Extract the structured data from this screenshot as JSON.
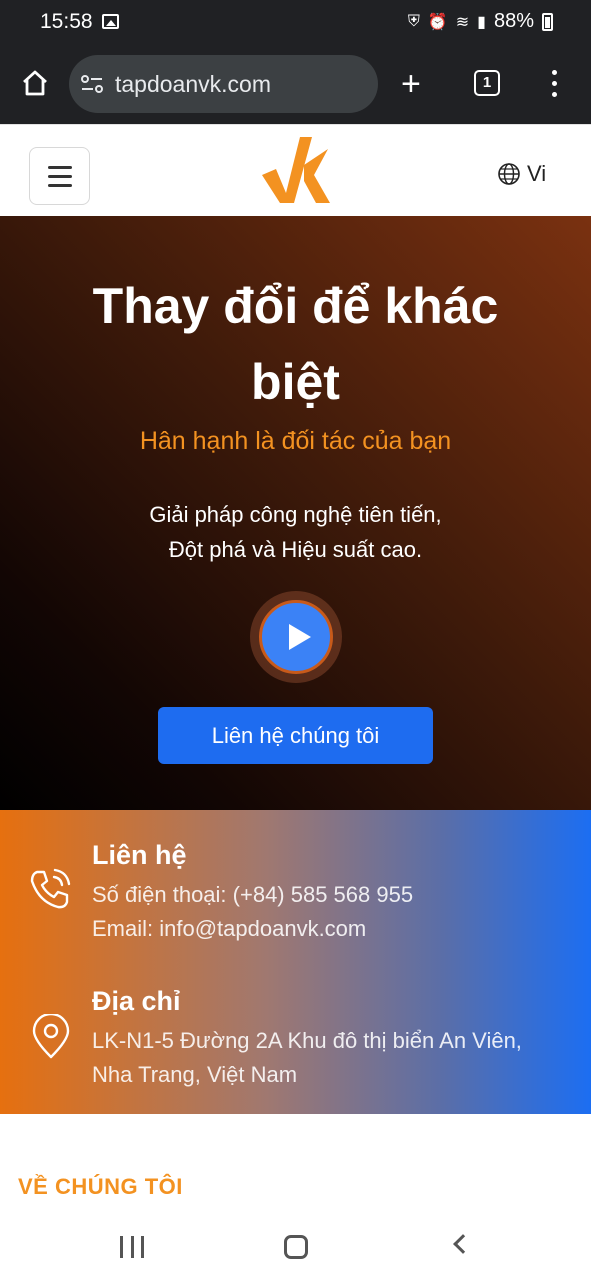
{
  "status_bar": {
    "time": "15:58",
    "battery": "88%"
  },
  "browser": {
    "url": "tapdoanvk.com",
    "tab_count": "1"
  },
  "header": {
    "language": "Vi",
    "brand_color": "#f39221"
  },
  "hero": {
    "title": "Thay đổi để khác biệt",
    "subtitle": "Hân hạnh là đối tác của bạn",
    "desc_line1": "Giải pháp công nghệ tiên tiến,",
    "desc_line2": "Đột phá và Hiệu suất cao.",
    "cta": "Liên hệ chúng tôi"
  },
  "contact": {
    "title": "Liên hệ",
    "phone": "Số điện thoại: (+84) 585 568 955",
    "email": "Email: info@tapdoanvk.com"
  },
  "address": {
    "title": "Địa chỉ",
    "line1": "LK-N1-5 Đường 2A Khu đô thị biển An Viên,",
    "line2": "Nha Trang, Việt Nam"
  },
  "about": {
    "title": "VỀ CHÚNG TÔI"
  },
  "colors": {
    "accent": "#f39221",
    "cta_blue": "#1e6cf0"
  }
}
